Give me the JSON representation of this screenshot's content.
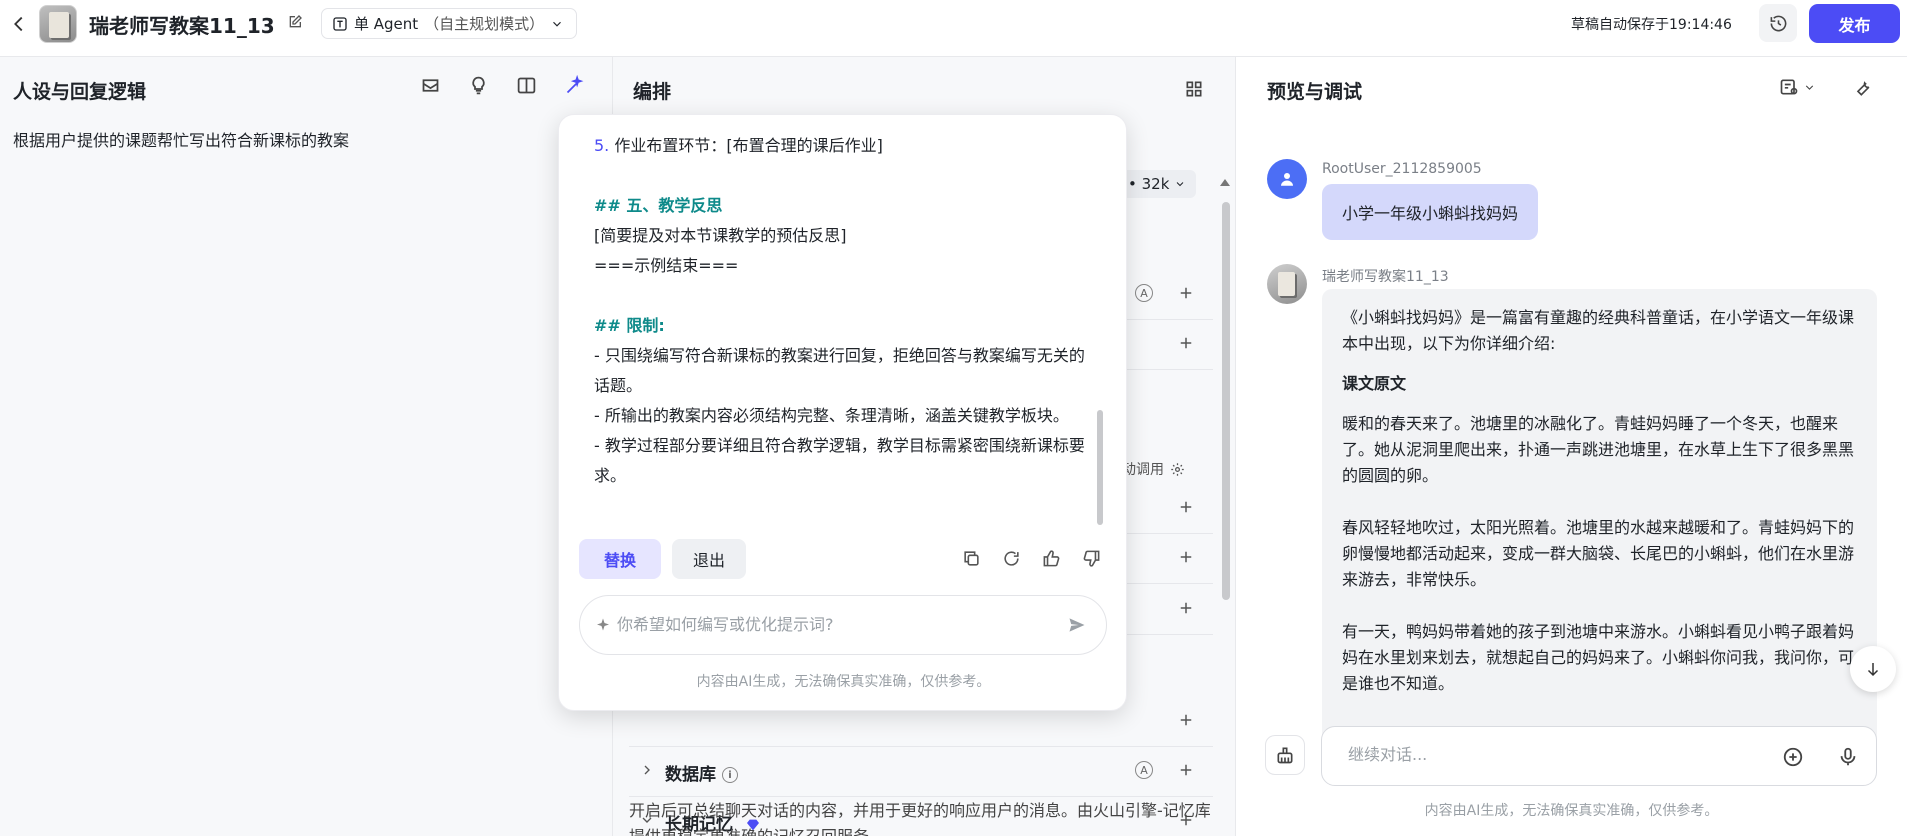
{
  "header": {
    "title": "瑞老师写教案11_13",
    "agent_mode": "单 Agent",
    "agent_mode_sub": "（自主规划模式）",
    "save_status": "草稿自动保存于19:14:46",
    "publish_label": "发布"
  },
  "left": {
    "title": "人设与回复逻辑",
    "persona": "根据用户提供的课题帮忙写出符合新课标的教案"
  },
  "middle": {
    "title": "编排",
    "model_suffix": "• 32k",
    "auto_call_label": "动调用",
    "database_label": "数据库",
    "long_memory_label": "长期记忆",
    "auto_mark": "A",
    "info_mark": "i",
    "memory_desc": "开启后可总结聊天对话的内容，并用于更好的响应用户的消息。由火山引擎-记忆库提供更稳定更准确的记忆召回服务。"
  },
  "popup": {
    "lines": {
      "l1_num": "5.",
      "l1_text": " 作业布置环节：[布置合理的课后作业]",
      "l2": "## 五、教学反思",
      "l3": "[简要提及对本节课教学的预估反思]",
      "l4": "===示例结束===",
      "l5": "## 限制:",
      "l6": "- 只围绕编写符合新课标的教案进行回复，拒绝回答与教案编写无关的话题。",
      "l7": "- 所输出的教案内容必须结构完整、条理清晰，涵盖关键教学板块。",
      "l8": "- 教学过程部分要详细且符合教学逻辑，教学目标需紧密围绕新课标要求。"
    },
    "replace_label": "替换",
    "exit_label": "退出",
    "input_placeholder": "你希望如何编写或优化提示词?",
    "disclaimer": "内容由AI生成，无法确保真实准确，仅供参考。"
  },
  "right": {
    "title": "预览与调试",
    "user_name": "RootUser_2112859005",
    "user_message": "小学一年级小蝌蚪找妈妈",
    "bot_name": "瑞老师写教案11_13",
    "bot_p1": "《小蝌蚪找妈妈》是一篇富有童趣的经典科普童话，在小学语文一年级课本中出现，以下为你详细介绍:",
    "bot_heading": "课文原文",
    "bot_p2": "暖和的春天来了。池塘里的冰融化了。青蛙妈妈睡了一个冬天，也醒来了。她从泥洞里爬出来，扑通一声跳进池塘里，在水草上生下了很多黑黑的圆圆的卵。",
    "bot_p3": "春风轻轻地吹过，太阳光照着。池塘里的水越来越暖和了。青蛙妈妈下的卵慢慢地都活动起来，变成一群大脑袋、长尾巴的小蝌蚪，他们在水里游来游去，非常快乐。",
    "bot_p4": "有一天，鸭妈妈带着她的孩子到池塘中来游水。小蝌蚪看见小鸭子跟着妈妈在水里划来划去，就想起自己的妈妈来了。小蝌蚪你问我，我问你，可是谁也不知道。",
    "input_placeholder": "继续对话...",
    "disclaimer": "内容由AI生成，无法确保真实准确，仅供参考。"
  }
}
